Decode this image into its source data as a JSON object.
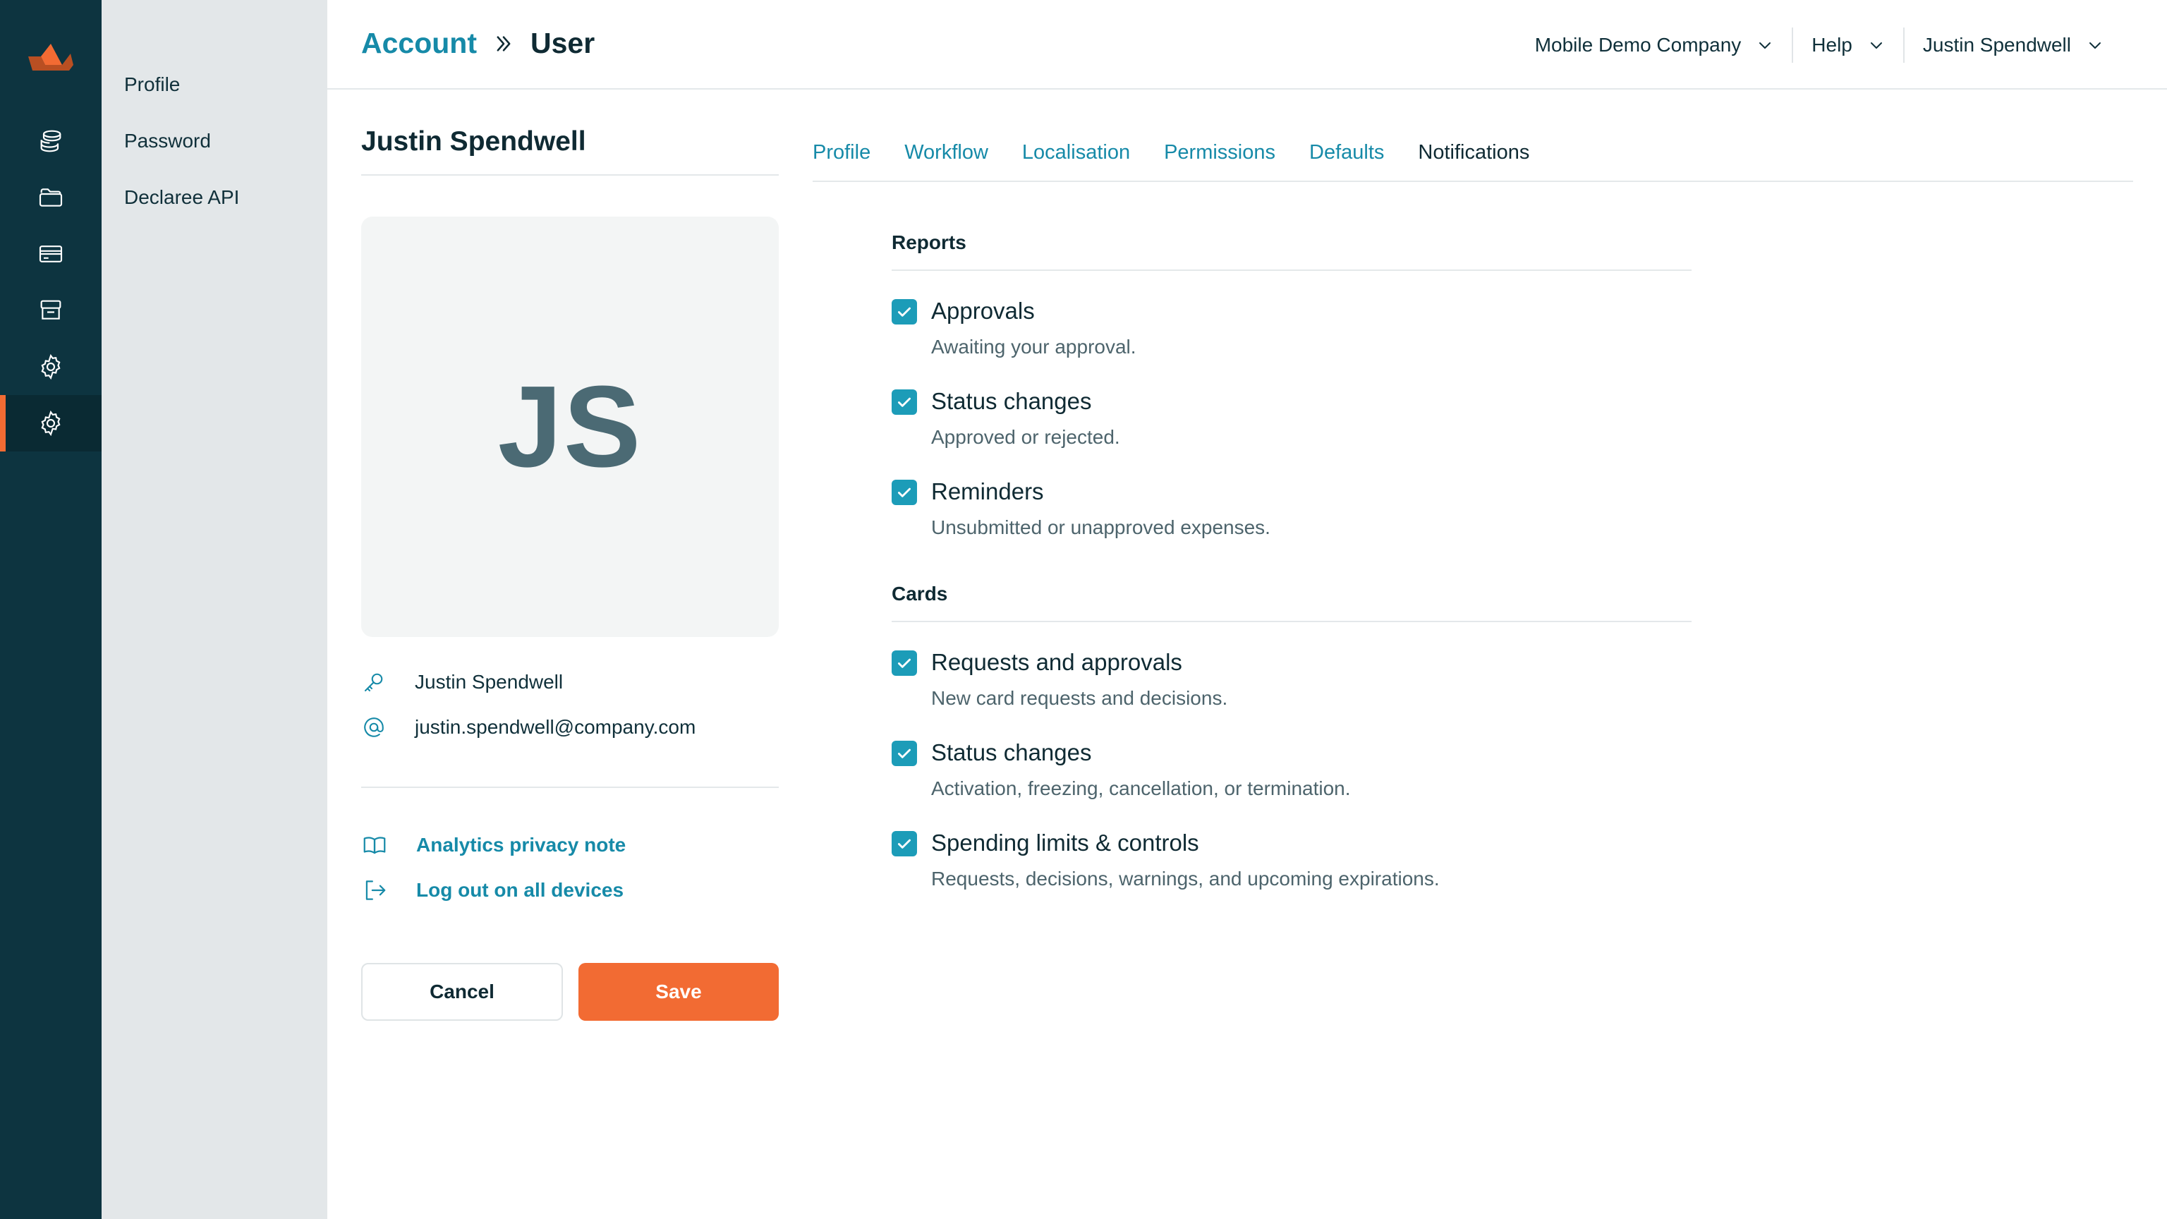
{
  "colors": {
    "rail": "#0d3440",
    "accent": "#f26b33",
    "link": "#168aa8",
    "checkbox": "#1c9cb8"
  },
  "sidebar": {
    "icons": [
      "logo-icon",
      "stack-icon",
      "folder-icon",
      "card-icon",
      "store-icon",
      "gear-icon",
      "gear-icon"
    ],
    "active_index": 5
  },
  "subnav": {
    "items": [
      {
        "label": "Profile"
      },
      {
        "label": "Password"
      },
      {
        "label": "Declaree API"
      }
    ]
  },
  "header": {
    "breadcrumb": {
      "parent": "Account",
      "current": "User"
    },
    "company": "Mobile Demo Company",
    "help": "Help",
    "user": "Justin Spendwell"
  },
  "profile": {
    "name": "Justin Spendwell",
    "initials": "JS",
    "username": "Justin Spendwell",
    "email": "justin.spendwell@company.com",
    "privacy_link": "Analytics privacy note",
    "logout_link": "Log out on all devices",
    "cancel_label": "Cancel",
    "save_label": "Save"
  },
  "tabs": [
    {
      "label": "Profile"
    },
    {
      "label": "Workflow"
    },
    {
      "label": "Localisation"
    },
    {
      "label": "Permissions"
    },
    {
      "label": "Defaults"
    },
    {
      "label": "Notifications",
      "active": true
    }
  ],
  "notifications": {
    "reports": {
      "title": "Reports",
      "items": [
        {
          "label": "Approvals",
          "desc": "Awaiting your approval.",
          "checked": true
        },
        {
          "label": "Status changes",
          "desc": "Approved or rejected.",
          "checked": true
        },
        {
          "label": "Reminders",
          "desc": "Unsubmitted or unapproved expenses.",
          "checked": true
        }
      ]
    },
    "cards": {
      "title": "Cards",
      "items": [
        {
          "label": "Requests and approvals",
          "desc": "New card requests and decisions.",
          "checked": true
        },
        {
          "label": "Status changes",
          "desc": "Activation, freezing, cancellation, or termination.",
          "checked": true
        },
        {
          "label": "Spending limits & controls",
          "desc": "Requests, decisions, warnings, and upcoming expirations.",
          "checked": true
        }
      ]
    }
  }
}
